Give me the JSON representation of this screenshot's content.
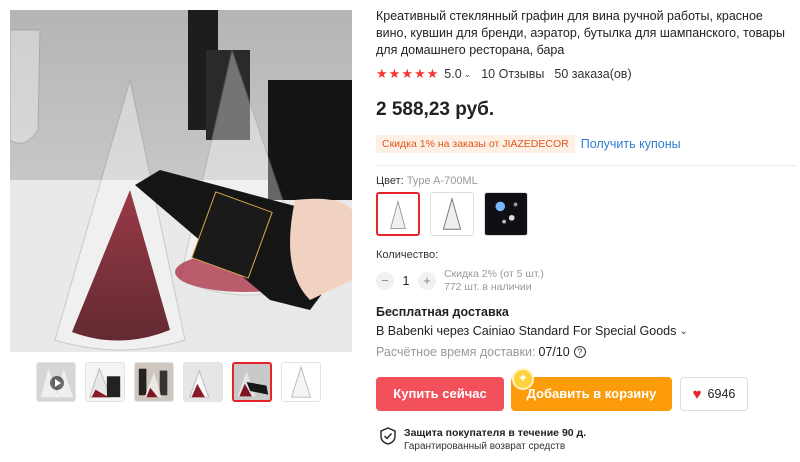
{
  "product": {
    "title": "Креативный стеклянный графин для вина ручной работы, красное вино, кувшин для бренди, аэратор, бутылка для шампанского, товары для домашнего ресторана, бара",
    "rating": "5.0",
    "reviews": "10 Отзывы",
    "orders": "50 заказа(ов)",
    "price": "2 588,23 руб."
  },
  "coupon": {
    "text": "Скидка 1% на заказы от JIAZEDECOR",
    "link": "Получить купоны"
  },
  "color": {
    "label": "Цвет:",
    "value": "Type A-700ML"
  },
  "quantity": {
    "label": "Количество:",
    "value": "1",
    "discount": "Скидка 2% (от 5 шт.)",
    "stock": "772 шт. в наличии"
  },
  "shipping": {
    "title": "Бесплатная доставка",
    "line": "В Babenki через Cainiao Standard For Special Goods",
    "eta_label": "Расчётное время доставки:",
    "eta_value": "07/10"
  },
  "actions": {
    "buy": "Купить сейчас",
    "cart": "Добавить в корзину",
    "wishlist_count": "6946"
  },
  "protection": {
    "title": "Защита покупателя в течение 90 д.",
    "subtitle": "Гарантированный возврат средств"
  },
  "icons": [
    "star-icon",
    "chevron-down-icon",
    "play-icon",
    "question-icon",
    "heart-icon",
    "shield-check-icon"
  ],
  "colors": {
    "accent": "#f2505a",
    "cart": "#fc9c0b",
    "link": "#2e7dd1",
    "star": "#f5352e"
  }
}
